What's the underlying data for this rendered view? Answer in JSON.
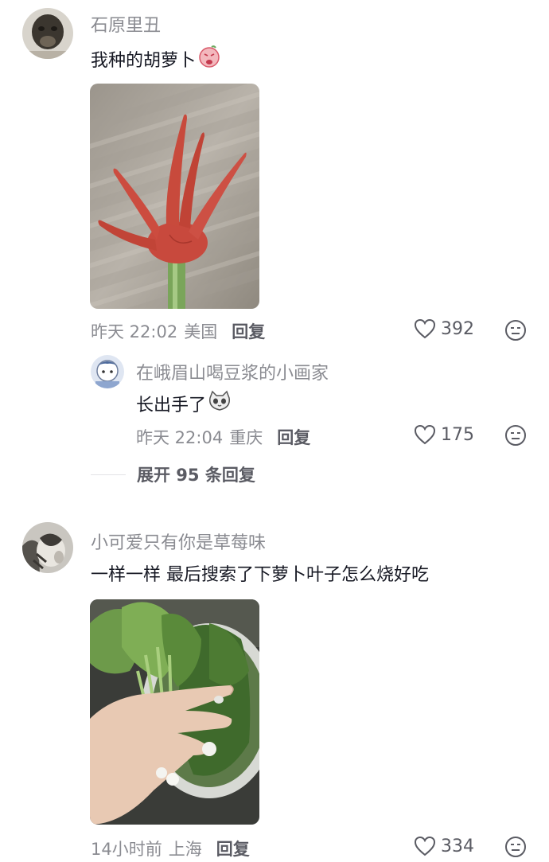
{
  "comments": [
    {
      "username": "石原里丑",
      "text": "我种的胡萝卜",
      "time": "昨天 22:02",
      "location": "美国",
      "reply_label": "回复",
      "likes": "392",
      "inline_emoji": "crying-face-emoji",
      "image": "hand-shaped-carrot-photo",
      "replies": [
        {
          "username": "在峨眉山喝豆浆的小画家",
          "text": "长出手了",
          "time": "昨天 22:04",
          "location": "重庆",
          "reply_label": "回复",
          "likes": "175",
          "inline_emoji": "cat-face-emoji"
        }
      ],
      "expand_label": "展开 95 条回复"
    },
    {
      "username": "小可爱只有你是草莓味",
      "text": "一样一样 最后搜索了下萝卜叶子怎么烧好吃",
      "time": "14小时前",
      "location": "上海",
      "reply_label": "回复",
      "likes": "334",
      "image": "radish-greens-photo"
    }
  ],
  "icons": {
    "like": "heart-outline-icon",
    "emoji": "neutral-face-icon"
  },
  "colors": {
    "text_primary": "#161823",
    "text_secondary": "#8a8b91",
    "carrot": "#c8493d",
    "background": "#ffffff"
  }
}
